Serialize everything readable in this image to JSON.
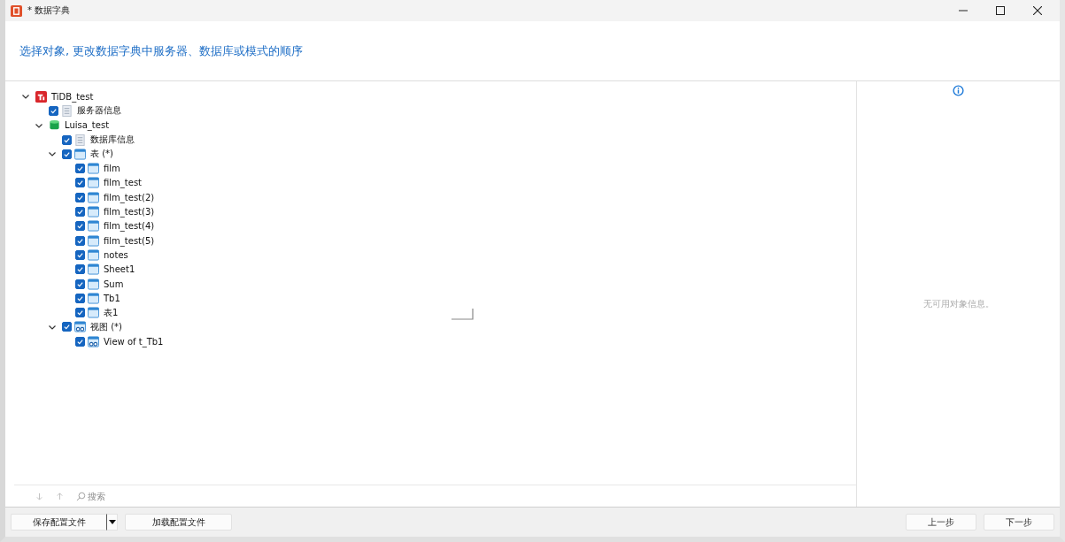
{
  "window": {
    "title": "* 数据字典"
  },
  "header": {
    "instruction": "选择对象, 更改数据字典中服务器、数据库或模式的顺序"
  },
  "tree": [
    {
      "label": "TiDB_test",
      "kind": "server",
      "expanded": true,
      "children": [
        {
          "label": "服务器信息",
          "kind": "info",
          "checked": true
        },
        {
          "label": "Luisa_test",
          "kind": "database",
          "expanded": true,
          "children": [
            {
              "label": "数据库信息",
              "kind": "info",
              "checked": true
            },
            {
              "label": "表 (*)",
              "kind": "table-group",
              "checked": true,
              "expanded": true,
              "children": [
                {
                  "label": "film",
                  "kind": "table",
                  "checked": true
                },
                {
                  "label": "film_test",
                  "kind": "table",
                  "checked": true
                },
                {
                  "label": "film_test(2)",
                  "kind": "table",
                  "checked": true
                },
                {
                  "label": "film_test(3)",
                  "kind": "table",
                  "checked": true
                },
                {
                  "label": "film_test(4)",
                  "kind": "table",
                  "checked": true
                },
                {
                  "label": "film_test(5)",
                  "kind": "table",
                  "checked": true
                },
                {
                  "label": "notes",
                  "kind": "table",
                  "checked": true
                },
                {
                  "label": "Sheet1",
                  "kind": "table",
                  "checked": true
                },
                {
                  "label": "Sum",
                  "kind": "table",
                  "checked": true
                },
                {
                  "label": "Tb1",
                  "kind": "table",
                  "checked": true
                },
                {
                  "label": "表1",
                  "kind": "table",
                  "checked": true
                }
              ]
            },
            {
              "label": "视图 (*)",
              "kind": "view-group",
              "checked": true,
              "expanded": true,
              "children": [
                {
                  "label": "View of t_Tb1",
                  "kind": "view",
                  "checked": true
                }
              ]
            }
          ]
        }
      ]
    }
  ],
  "search": {
    "placeholder": "搜索"
  },
  "info_panel": {
    "message": "无可用对象信息。"
  },
  "footer": {
    "left_buttons": [
      {
        "label": "保存配置文件",
        "kind": "split"
      },
      {
        "label": "加载配置文件",
        "kind": "plain"
      }
    ],
    "right_buttons": [
      {
        "label": "上一步"
      },
      {
        "label": "下一步"
      }
    ]
  }
}
